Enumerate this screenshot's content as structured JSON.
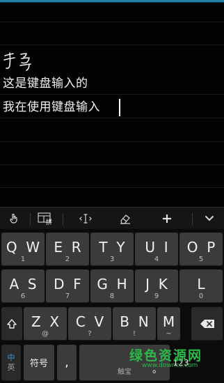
{
  "text_area": {
    "handwriting_text": "手写",
    "line1": "这是键盘输入的",
    "line2": "我在使用键盘输入"
  },
  "toolbar": {
    "items": [
      "hand-pointer-icon",
      "pinyin-grid-icon",
      "cursor-move-icon",
      "eraser-icon",
      "plus-icon",
      "chevron-down-icon"
    ],
    "pinyin_label": "拼"
  },
  "keyboard": {
    "row1": [
      {
        "key": "Q",
        "sub": "1"
      },
      {
        "key": "W",
        "sub": "1"
      },
      {
        "key": "E",
        "sub": "2"
      },
      {
        "key": "R",
        "sub": "2"
      },
      {
        "key": "T",
        "sub": "3"
      },
      {
        "key": "Y",
        "sub": "3"
      },
      {
        "key": "U",
        "sub": "4"
      },
      {
        "key": "I",
        "sub": "4"
      },
      {
        "key": "O",
        "sub": "5"
      },
      {
        "key": "P",
        "sub": "5"
      }
    ],
    "row2": [
      {
        "key": "A",
        "sub": "6"
      },
      {
        "key": "S",
        "sub": "6"
      },
      {
        "key": "D",
        "sub": "7"
      },
      {
        "key": "F",
        "sub": "7"
      },
      {
        "key": "G",
        "sub": "8"
      },
      {
        "key": "H",
        "sub": "8"
      },
      {
        "key": "J",
        "sub": "9"
      },
      {
        "key": "K",
        "sub": "9"
      },
      {
        "key": "L",
        "sub": "0"
      }
    ],
    "row3": [
      {
        "key": "Z",
        "sub": "@"
      },
      {
        "key": "X",
        "sub": "@"
      },
      {
        "key": "C",
        "sub": "?"
      },
      {
        "key": "V",
        "sub": "?"
      },
      {
        "key": "B",
        "sub": "!"
      },
      {
        "key": "N",
        "sub": "!"
      },
      {
        "key": "M",
        "sub": "~"
      }
    ],
    "bottom": {
      "lang_top": "中",
      "lang_bottom": "英",
      "symbols": "符号",
      "comma": ",",
      "space": "触宝",
      "period": "。",
      "numbers": "123"
    }
  },
  "watermark": {
    "line1": "绿色资源网",
    "line2": "www.downcc.com"
  },
  "colors": {
    "accent": "#1f7fa6",
    "key": "#3b3b3b",
    "background": "#000000",
    "watermark": "#2db84a",
    "lang_active": "#3d9bd6"
  }
}
